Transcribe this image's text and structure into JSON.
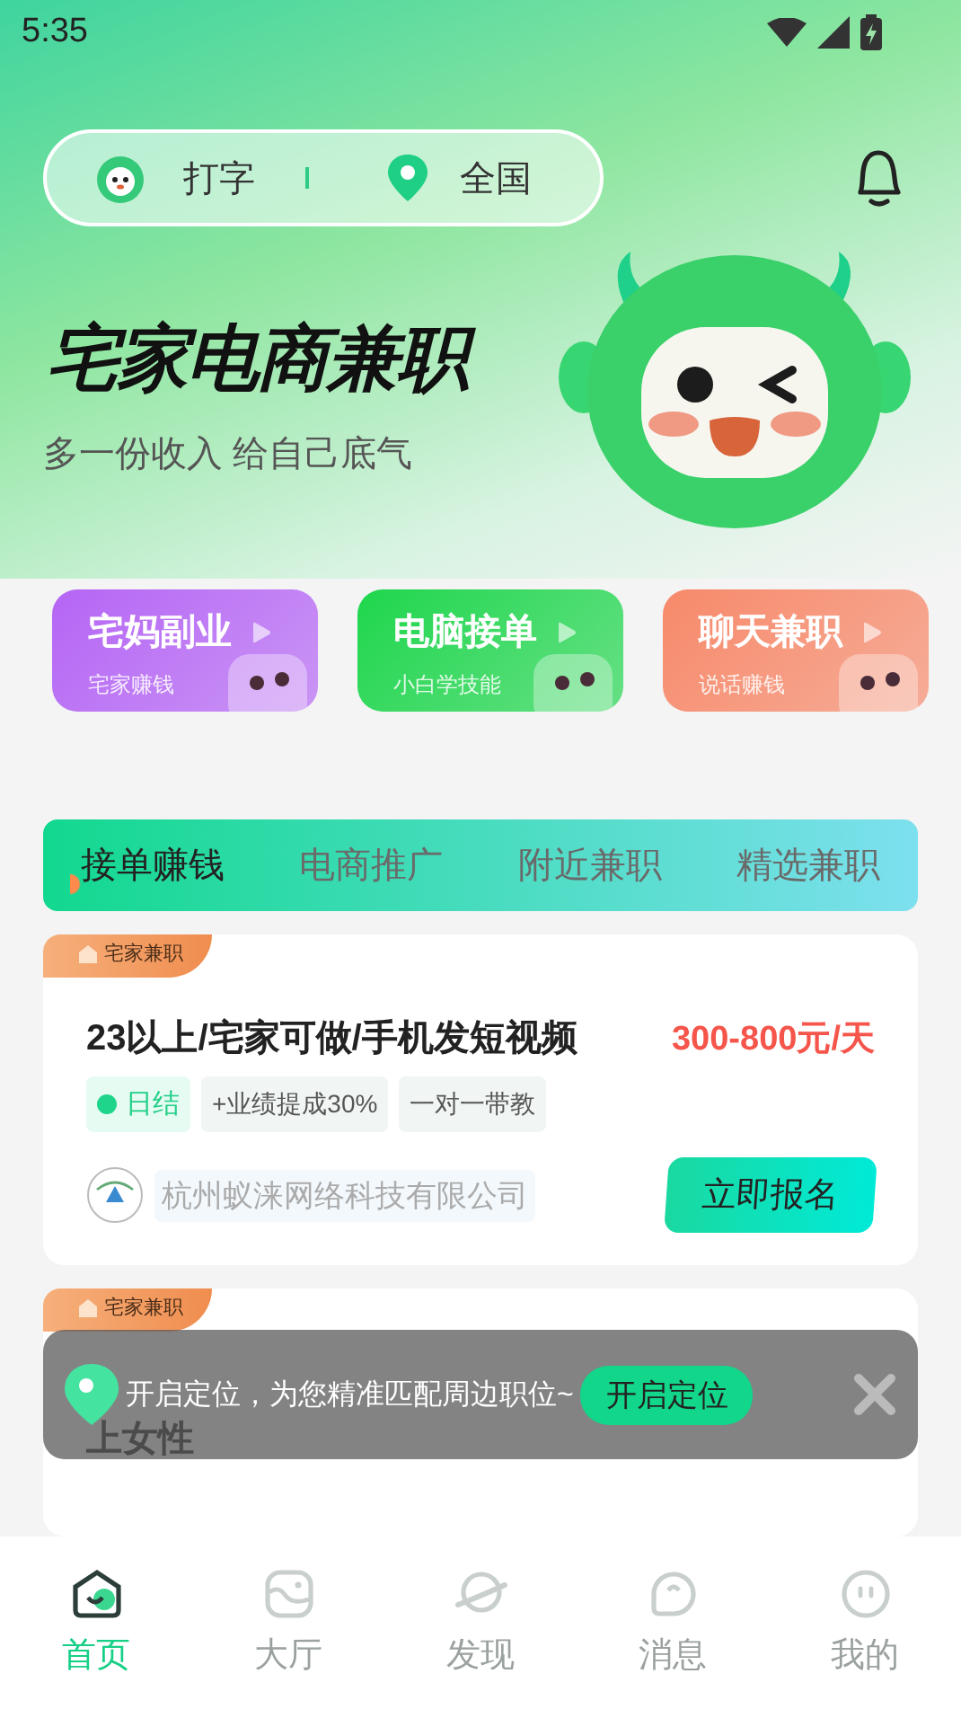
{
  "status_bar": {
    "time": "5:35"
  },
  "header": {
    "category": "打字",
    "location": "全国"
  },
  "hero": {
    "title": "宅家电商兼职",
    "subtitle": "多一份收入 给自己底气"
  },
  "promo_cards": [
    {
      "title": "宅妈副业",
      "subtitle": "宅家赚钱",
      "color": "#b565f5"
    },
    {
      "title": "电脑接单",
      "subtitle": "小白学技能",
      "color": "#1fd64d"
    },
    {
      "title": "聊天兼职",
      "subtitle": "说话赚钱",
      "color": "#f7896a"
    }
  ],
  "tabs": [
    {
      "label": "接单赚钱",
      "selected": true
    },
    {
      "label": "电商推广",
      "selected": false
    },
    {
      "label": "附近兼职",
      "selected": false
    },
    {
      "label": "精选兼职",
      "selected": false
    }
  ],
  "jobs": [
    {
      "tag": "宅家兼职",
      "title": "23以上/宅家可做/手机发短视频",
      "salary": "300-800元/天",
      "badges": [
        {
          "label": "日结",
          "kind": "highlight"
        },
        {
          "label": "+业绩提成30%",
          "kind": "plain"
        },
        {
          "label": "一对一带教",
          "kind": "plain"
        }
      ],
      "company": "杭州蚁涞网络科技有限公司",
      "apply": "立即报名"
    },
    {
      "tag": "宅家兼职",
      "title": "上女性"
    }
  ],
  "toast": {
    "message": "开启定位，为您精准匹配周边职位~",
    "action": "开启定位"
  },
  "nav": [
    {
      "label": "首页",
      "selected": true,
      "kind": "home"
    },
    {
      "label": "大厅",
      "selected": false,
      "kind": "hall"
    },
    {
      "label": "发现",
      "selected": false,
      "kind": "discover"
    },
    {
      "label": "消息",
      "selected": false,
      "kind": "message"
    },
    {
      "label": "我的",
      "selected": false,
      "kind": "me"
    }
  ]
}
